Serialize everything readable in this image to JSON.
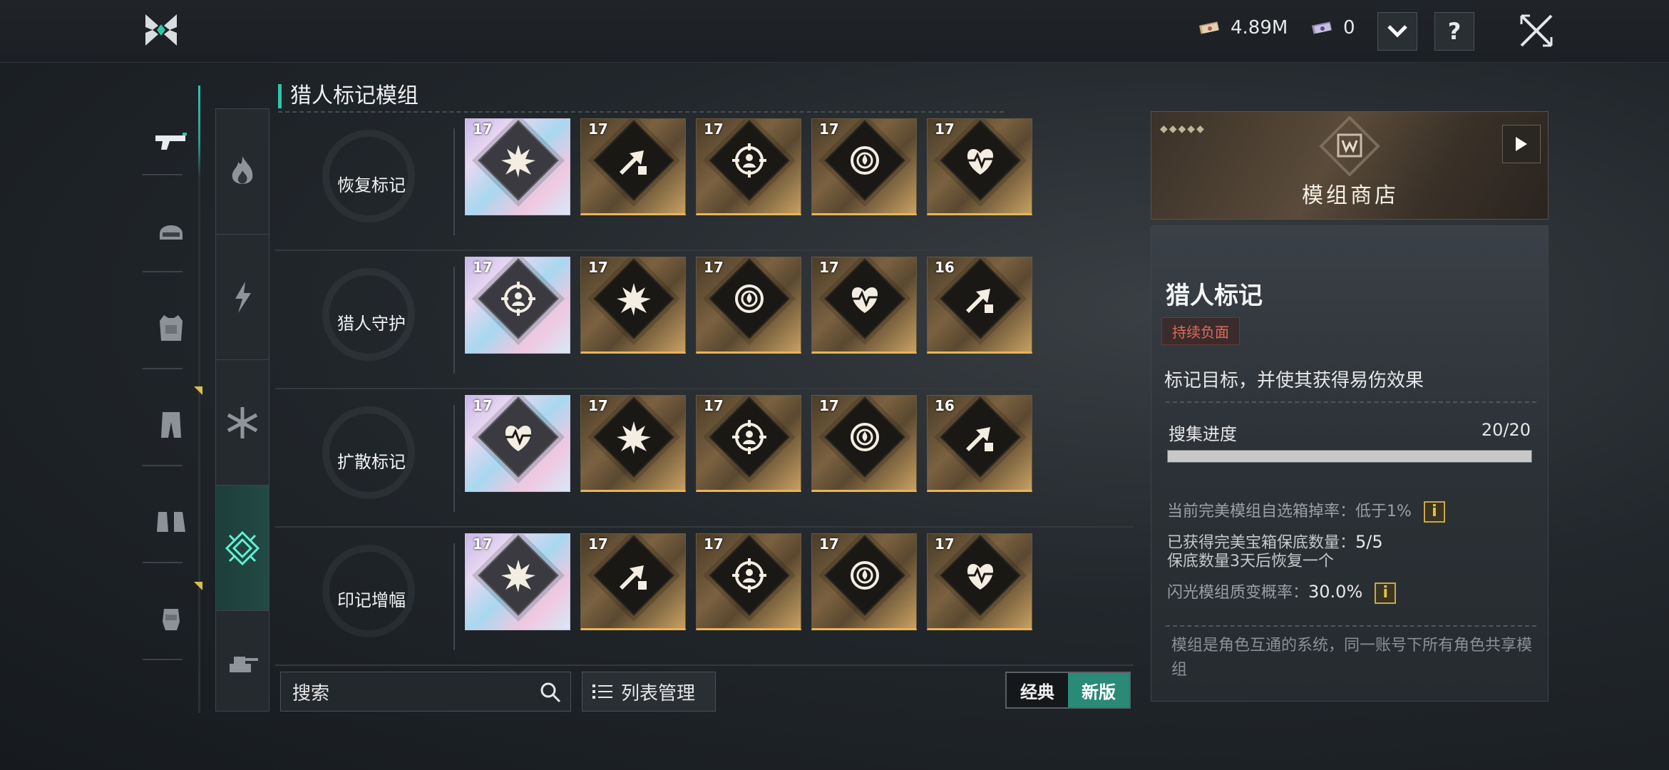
{
  "topbar": {
    "currency1": "4.89M",
    "currency2": "0",
    "help_label": "?"
  },
  "section": {
    "title": "猎人标记模组"
  },
  "rows": [
    {
      "label": "恢复标记",
      "cards": [
        {
          "level": "17",
          "style": "holo",
          "icon": "explosion-icon"
        },
        {
          "level": "17",
          "style": "gold",
          "icon": "arrow-burst-icon"
        },
        {
          "level": "17",
          "style": "gold",
          "icon": "crosshair-person-icon"
        },
        {
          "level": "17",
          "style": "gold",
          "icon": "target-drop-icon"
        },
        {
          "level": "17",
          "style": "gold",
          "icon": "heart-pulse-icon"
        }
      ]
    },
    {
      "label": "猎人守护",
      "cards": [
        {
          "level": "17",
          "style": "holo",
          "icon": "crosshair-person-icon"
        },
        {
          "level": "17",
          "style": "gold",
          "icon": "explosion-icon"
        },
        {
          "level": "17",
          "style": "gold",
          "icon": "target-drop-icon"
        },
        {
          "level": "17",
          "style": "gold",
          "icon": "heart-pulse-icon"
        },
        {
          "level": "16",
          "style": "gold",
          "icon": "arrow-burst-icon"
        }
      ]
    },
    {
      "label": "扩散标记",
      "cards": [
        {
          "level": "17",
          "style": "holo",
          "icon": "heart-pulse-icon"
        },
        {
          "level": "17",
          "style": "gold",
          "icon": "explosion-icon"
        },
        {
          "level": "17",
          "style": "gold",
          "icon": "crosshair-person-icon"
        },
        {
          "level": "17",
          "style": "gold",
          "icon": "target-drop-icon"
        },
        {
          "level": "16",
          "style": "gold",
          "icon": "arrow-burst-icon"
        }
      ]
    },
    {
      "label": "印记增幅",
      "cards": [
        {
          "level": "17",
          "style": "holo",
          "icon": "explosion-icon"
        },
        {
          "level": "17",
          "style": "gold",
          "icon": "arrow-burst-icon"
        },
        {
          "level": "17",
          "style": "gold",
          "icon": "crosshair-person-icon"
        },
        {
          "level": "17",
          "style": "gold",
          "icon": "target-drop-icon"
        },
        {
          "level": "17",
          "style": "gold",
          "icon": "heart-pulse-icon"
        }
      ]
    }
  ],
  "bottom": {
    "search_placeholder": "搜索",
    "list_manage": "列表管理",
    "toggle_classic": "经典",
    "toggle_new": "新版"
  },
  "shop": {
    "title": "模组商店"
  },
  "detail": {
    "title": "猎人标记",
    "tag": "持续负面",
    "description": "标记目标，并使其获得易伤效果",
    "progress_label": "搜集进度",
    "progress_value": "20/20",
    "progress_fraction": 1.0,
    "drop_rate_label": "当前完美模组自选箱掉率：",
    "drop_rate_value": "低于1%",
    "pity_label": "已获得完美宝箱保底数量：",
    "pity_value": "5/5",
    "pity_reset": "保底数量3天后恢复一个",
    "mutation_label": "闪光模组质变概率：",
    "mutation_value": "30.0%",
    "footer": "模组是角色互通的系统，同一账号下所有角色共享模组"
  },
  "colors": {
    "accent": "#2fc6a8",
    "gold": "#e8b45a",
    "tag_red": "#e06a5a"
  }
}
